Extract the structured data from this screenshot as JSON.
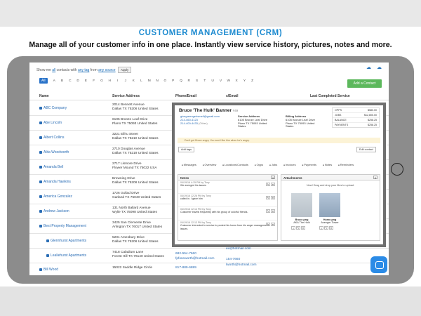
{
  "banner": {
    "title": "CUSTOMER MANAGEMENT (CRM)",
    "subtitle": "Manage all of your customer info in one place. Instantly view service history, pictures, notes and more."
  },
  "filter": {
    "show_me": "Show me",
    "all": "all",
    "contacts_with": "contacts with",
    "any_tag": "any tag",
    "from": "from",
    "any_source": "any source",
    "apply": "Apply"
  },
  "alphabet": {
    "all": "All",
    "letters": [
      "A",
      "B",
      "C",
      "D",
      "E",
      "F",
      "G",
      "H",
      "I",
      "J",
      "K",
      "L",
      "M",
      "N",
      "O",
      "P",
      "Q",
      "R",
      "S",
      "T",
      "U",
      "V",
      "W",
      "X",
      "Y",
      "Z"
    ]
  },
  "add_contact": "Add a Contact",
  "table": {
    "headers": {
      "name": "Name",
      "service_address": "Service Address",
      "phone_email": "Phone/Email",
      "email": "s/Email",
      "last_completed": "Last Completed Service"
    },
    "rows": [
      {
        "name": "ABC Company",
        "addr1": "2014 Bennett Avenue",
        "addr2": "Dallas TX 75206 United States"
      },
      {
        "name": "Abe Lincoln",
        "addr1": "6105 Bronze Leaf Drive",
        "addr2": "Plano TX 75093 United States"
      },
      {
        "name": "Albert Collins",
        "addr1": "3221 Elihu Street",
        "addr2": "Dallas TX 75210 United States"
      },
      {
        "name": "Alita Woodworth",
        "addr1": "2710 Douglas Avenue",
        "addr2": "Dallas TX 75219 United States"
      },
      {
        "name": "Amanda Bell",
        "addr1": "2717 Lismore Drive",
        "addr2": "Flower Mound TX 75022 USA"
      },
      {
        "name": "Amanda Hawkins",
        "addr1": "Browning Drive",
        "addr2": "Dallas TX 75206 United States"
      },
      {
        "name": "America Gonzalez",
        "addr1": "1726 Goliad Drive",
        "addr2": "Garland TX 75040 United States"
      },
      {
        "name": "Andrew Jackson",
        "addr1": "131 North Ballard Avenue",
        "addr2": "Wylie TX 75098 United States"
      },
      {
        "name": "Best Property Management",
        "addr1": "3425 San Clemente Drive",
        "addr2": "Arlington TX 76017 United States"
      },
      {
        "name": "Glennhurst Apartments",
        "addr1": "5201 Amesbury Drive",
        "addr2": "Dallas TX 75206 United States"
      },
      {
        "name": "Lealiehurst Apartments",
        "addr1": "7418 Caladium Lane",
        "addr2": "Forest Hill TX 76140 United States"
      },
      {
        "name": "Bill Wood",
        "addr1": "15022 Saddle Ridge Circle",
        "addr2": ""
      }
    ],
    "partial": {
      "phone1": "682-554-7660",
      "email1": "fpforwworth@hotmail.com",
      "phone2": "817-889-6889",
      "email2a": "ex@hotmail.com",
      "email2b": "154-7660",
      "email2c": "lworth@hotmail.com"
    }
  },
  "modal": {
    "name": "Bruce 'The Hulk' Banner",
    "id": "#49",
    "email": "givegreengehsmell@gmail.com",
    "phone1": "214-460-4123",
    "phone2": "214-400-4433",
    "phone2_label": "(Other)",
    "service_label": "Service Address",
    "service1": "6105 Bronze Leaf Drive",
    "service2": "Plano TX 75093 United",
    "service3": "States",
    "billing_label": "Billing Address",
    "billing1": "6105 Bronze Leaf Drive",
    "billing2": "Plano TX 75093 United",
    "billing3": "States",
    "stats": [
      {
        "label": "OPPS",
        "value": "$580.00"
      },
      {
        "label": "JOBS",
        "value": "$12,805.00"
      },
      {
        "label": "BALANCE",
        "value": "$258.25"
      },
      {
        "label": "PAYMENTS",
        "value": "$258.25"
      }
    ],
    "alert": "Don't get Bruce angry. You won't like him when he's angry.",
    "add_tags": "Add tags",
    "edit_contact": "Edit contact",
    "tabs": [
      "Messages",
      "Overview",
      "Locations/Contacts",
      "Opps",
      "Jobs",
      "Invoices",
      "Payments",
      "Notes",
      "Reminders"
    ],
    "notes_title": "Notes",
    "notes": [
      {
        "meta": "04/19/16 4:15 PM by Tony",
        "text": "We avenged his issues"
      },
      {
        "meta": "04/19/16 12:26 PM by Tony",
        "text": "called in. I gave him"
      },
      {
        "meta": "04/19/16 12:14 PM by Tony",
        "text": "Customer travels frequently with his group of colorful friends."
      },
      {
        "meta": "04/19/16 12:13 PM by Tony",
        "text": "Customer interested in service to protect his home from his anger management issues."
      }
    ],
    "attachments_title": "Attachments",
    "attachments_new": "New! Drag and drop your files to upload.",
    "files": [
      {
        "name": "Bruce.png",
        "caption": "AKA The Hulk"
      },
      {
        "name": "Home.png",
        "caption": "Avenger Tower"
      }
    ]
  }
}
